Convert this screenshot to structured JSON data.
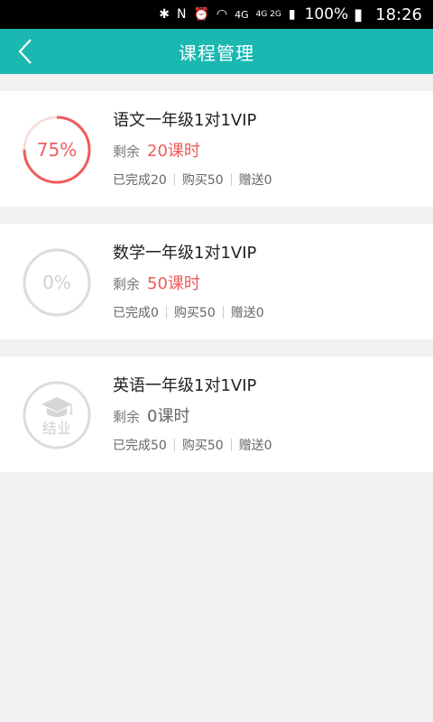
{
  "status_bar": {
    "network": "4G",
    "network2": "4G 2G",
    "battery": "100%",
    "time": "18:26"
  },
  "header": {
    "title": "课程管理",
    "back_icon": "chevron-left-icon"
  },
  "colors": {
    "accent": "#1bb8b2",
    "progress": "#ee5c5c",
    "muted": "#dcdcdc"
  },
  "courses": [
    {
      "title": "语文一年级1对1VIP",
      "remaining_label": "剩余",
      "remaining_value": "20课时",
      "progress_text": "75%",
      "progress": 0.75,
      "completed": "已完成20",
      "purchased": "购买50",
      "gift": "赠送0"
    },
    {
      "title": "数学一年级1对1VIP",
      "remaining_label": "剩余",
      "remaining_value": "50课时",
      "progress_text": "0%",
      "progress": 0,
      "completed": "已完成0",
      "purchased": "购买50",
      "gift": "赠送0"
    },
    {
      "title": "英语一年级1对1VIP",
      "remaining_label": "剩余",
      "remaining_value": "0课时",
      "graduated_text": "结业",
      "graduated_icon": "graduation-cap-icon",
      "completed": "已完成50",
      "purchased": "购买50",
      "gift": "赠送0"
    }
  ]
}
